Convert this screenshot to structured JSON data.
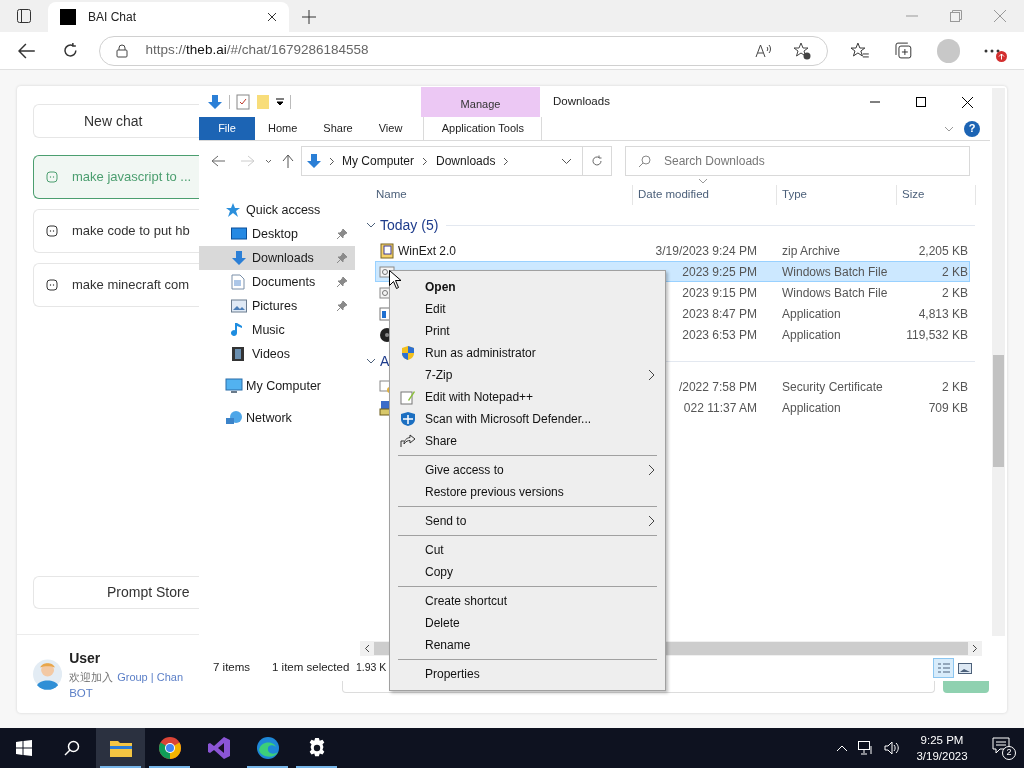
{
  "browser": {
    "tab": {
      "title": "BAI Chat",
      "selected": true
    },
    "url": {
      "scheme": "https://",
      "host": "theb.ai",
      "path": "/#/chat/1679286184558"
    }
  },
  "chat": {
    "new_chat": "New chat",
    "conversations": [
      {
        "title": "make javascript to ...",
        "selected": true
      },
      {
        "title": "make code to put hb",
        "selected": false
      },
      {
        "title": "make minecraft com",
        "selected": false
      }
    ],
    "prompt_store": "Prompt Store",
    "user": {
      "name": "User",
      "welcome": "欢迎加入",
      "link": "Group | Chan",
      "link_line2": "BOT"
    }
  },
  "explorer": {
    "title": "Downloads",
    "context_tab": "Manage",
    "ribbon_tabs": [
      {
        "label": "File",
        "kind": "file",
        "selected": false
      },
      {
        "label": "Home",
        "kind": "plain",
        "selected": false
      },
      {
        "label": "Share",
        "kind": "plain",
        "selected": false
      },
      {
        "label": "View",
        "kind": "plain",
        "selected": false
      },
      {
        "label": "Application Tools",
        "kind": "context",
        "selected": false
      }
    ],
    "help": "?",
    "breadcrumb": [
      "My Computer",
      "Downloads"
    ],
    "search_placeholder": "Search Downloads",
    "nav": [
      {
        "label": "Quick access",
        "kind": "star",
        "selected": false,
        "pinned": false,
        "children": [
          {
            "label": "Desktop",
            "kind": "desktop",
            "selected": false,
            "pinned": true
          },
          {
            "label": "Downloads",
            "kind": "downloads",
            "selected": true,
            "pinned": true
          },
          {
            "label": "Documents",
            "kind": "documents",
            "selected": false,
            "pinned": true
          },
          {
            "label": "Pictures",
            "kind": "pictures",
            "selected": false,
            "pinned": true
          },
          {
            "label": "Music",
            "kind": "music",
            "selected": false,
            "pinned": false
          },
          {
            "label": "Videos",
            "kind": "videos",
            "selected": false,
            "pinned": false
          }
        ]
      },
      {
        "label": "My Computer",
        "kind": "computer",
        "selected": false,
        "pinned": false
      },
      {
        "label": "Network",
        "kind": "network",
        "selected": false,
        "pinned": false
      }
    ],
    "columns": [
      "Name",
      "Date modified",
      "Type",
      "Size"
    ],
    "groups": [
      {
        "title": "Today (5)",
        "expanded": true,
        "files": [
          {
            "kind": "zip",
            "name": "WinExt 2.0",
            "date": "3/19/2023 9:24 PM",
            "type": "zip Archive",
            "size": "2,205 KB",
            "selected": false
          },
          {
            "kind": "batch",
            "date": "2023 9:25 PM",
            "type": "Windows Batch File",
            "size": "2 KB",
            "selected": true
          },
          {
            "kind": "batch",
            "date": "2023 9:15 PM",
            "type": "Windows Batch File",
            "size": "2 KB",
            "selected": false
          },
          {
            "kind": "app",
            "date": "2023 8:47 PM",
            "type": "Application",
            "size": "4,813 KB",
            "selected": false
          },
          {
            "kind": "disc",
            "date": "2023 6:53 PM",
            "type": "Application",
            "size": "119,532 KB",
            "selected": false
          }
        ]
      },
      {
        "title": "A",
        "expanded": true,
        "files": [
          {
            "kind": "certificate",
            "date": "/2022 7:58 PM",
            "type": "Security Certificate",
            "size": "2 KB",
            "selected": false
          },
          {
            "kind": "installer",
            "date": "022 11:37 AM",
            "type": "Application",
            "size": "709 KB",
            "selected": false
          }
        ]
      }
    ],
    "status": {
      "count": "7 items",
      "selection": "1 item selected",
      "size": "1.93 K"
    },
    "views": [
      {
        "kind": "details",
        "selected": true
      },
      {
        "kind": "tiles",
        "selected": false
      }
    ]
  },
  "context_menu": [
    {
      "kind": "item",
      "label": "Open",
      "default": true,
      "submenu": false
    },
    {
      "kind": "item",
      "label": "Edit",
      "default": false,
      "submenu": false
    },
    {
      "kind": "item",
      "label": "Print",
      "default": false,
      "submenu": false
    },
    {
      "kind": "shield",
      "label": "Run as administrator",
      "default": false,
      "submenu": false
    },
    {
      "kind": "item",
      "label": "7-Zip",
      "default": false,
      "submenu": true
    },
    {
      "kind": "notepad",
      "label": "Edit with Notepad++",
      "default": false,
      "submenu": false
    },
    {
      "kind": "defender",
      "label": "Scan with Microsoft Defender...",
      "default": false,
      "submenu": false
    },
    {
      "kind": "share",
      "label": "Share",
      "default": false,
      "submenu": false
    },
    {
      "kind": "separator"
    },
    {
      "kind": "item",
      "label": "Give access to",
      "default": false,
      "submenu": true
    },
    {
      "kind": "item",
      "label": "Restore previous versions",
      "default": false,
      "submenu": false
    },
    {
      "kind": "separator"
    },
    {
      "kind": "item",
      "label": "Send to",
      "default": false,
      "submenu": true
    },
    {
      "kind": "separator"
    },
    {
      "kind": "item",
      "label": "Cut",
      "default": false,
      "submenu": false
    },
    {
      "kind": "item",
      "label": "Copy",
      "default": false,
      "submenu": false
    },
    {
      "kind": "separator"
    },
    {
      "kind": "item",
      "label": "Create shortcut",
      "default": false,
      "submenu": false
    },
    {
      "kind": "item",
      "label": "Delete",
      "default": false,
      "submenu": false
    },
    {
      "kind": "item",
      "label": "Rename",
      "default": false,
      "submenu": false
    },
    {
      "kind": "separator"
    },
    {
      "kind": "item",
      "label": "Properties",
      "default": false,
      "submenu": false
    }
  ],
  "taskbar": {
    "apps": [
      {
        "kind": "explorer",
        "running": true,
        "active": true
      },
      {
        "kind": "chrome",
        "running": true,
        "active": false
      },
      {
        "kind": "vs",
        "running": false,
        "active": false
      },
      {
        "kind": "edge",
        "running": true,
        "active": false
      },
      {
        "kind": "settings",
        "running": true,
        "active": false
      }
    ],
    "time": "9:25 PM",
    "date": "3/19/2023",
    "notifications": "2"
  }
}
